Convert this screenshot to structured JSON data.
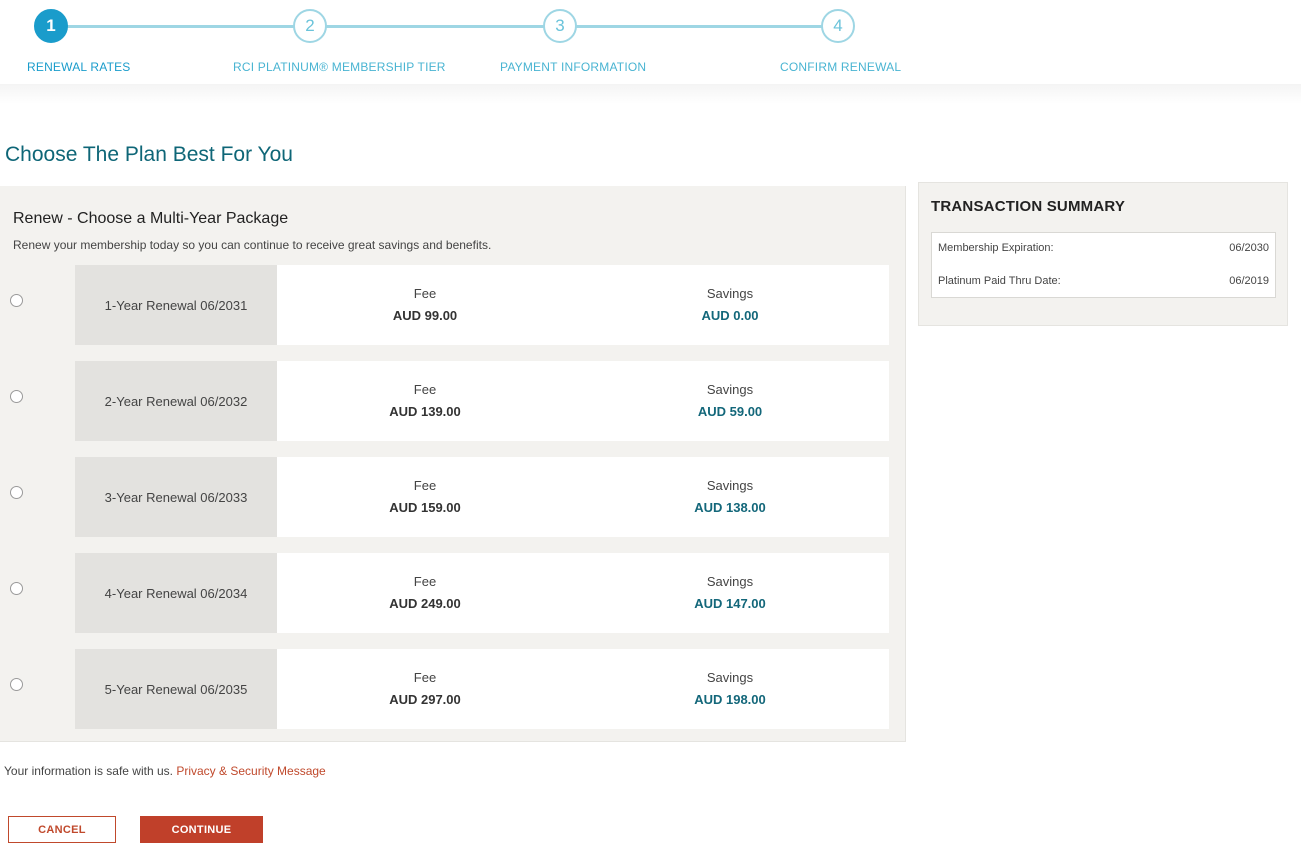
{
  "stepper": {
    "steps": [
      {
        "number": "1",
        "label": "RENEWAL RATES"
      },
      {
        "number": "2",
        "label": "RCI PLATINUM® MEMBERSHIP TIER"
      },
      {
        "number": "3",
        "label": "PAYMENT INFORMATION"
      },
      {
        "number": "4",
        "label": "CONFIRM RENEWAL"
      }
    ],
    "active_step": "1"
  },
  "page": {
    "title": "Choose The Plan Best For You"
  },
  "packages": {
    "title": "Renew - Choose a Multi-Year Package",
    "description": "Renew your membership today so you can continue to receive great savings and benefits.",
    "fee_label": "Fee",
    "savings_label": "Savings",
    "plans": [
      {
        "name": "1-Year Renewal 06/2031",
        "fee": "AUD 99.00",
        "savings": "AUD 0.00",
        "selected": false
      },
      {
        "name": "2-Year Renewal 06/2032",
        "fee": "AUD 139.00",
        "savings": "AUD 59.00",
        "selected": false
      },
      {
        "name": "3-Year Renewal 06/2033",
        "fee": "AUD 159.00",
        "savings": "AUD 138.00",
        "selected": false
      },
      {
        "name": "4-Year Renewal 06/2034",
        "fee": "AUD 249.00",
        "savings": "AUD 147.00",
        "selected": false
      },
      {
        "name": "5-Year Renewal 06/2035",
        "fee": "AUD 297.00",
        "savings": "AUD 198.00",
        "selected": false
      }
    ]
  },
  "summary": {
    "title": "TRANSACTION SUMMARY",
    "rows": [
      {
        "label": "Membership Expiration:",
        "value": "06/2030"
      },
      {
        "label": "Platinum Paid Thru Date:",
        "value": "06/2019"
      }
    ]
  },
  "footer": {
    "safe_text": "Your information is safe with us.",
    "privacy_link": "Privacy & Security Message",
    "cancel_label": "CANCEL",
    "continue_label": "CONTINUE"
  },
  "colors": {
    "accent": "#1a9ccb",
    "step_line": "#9ed6e4",
    "title": "#0e6677",
    "savings": "#13677a",
    "action": "#c0402a",
    "panel_bg": "#f3f2ef"
  },
  "icons": {
    "radio": "radio-button-icon"
  }
}
